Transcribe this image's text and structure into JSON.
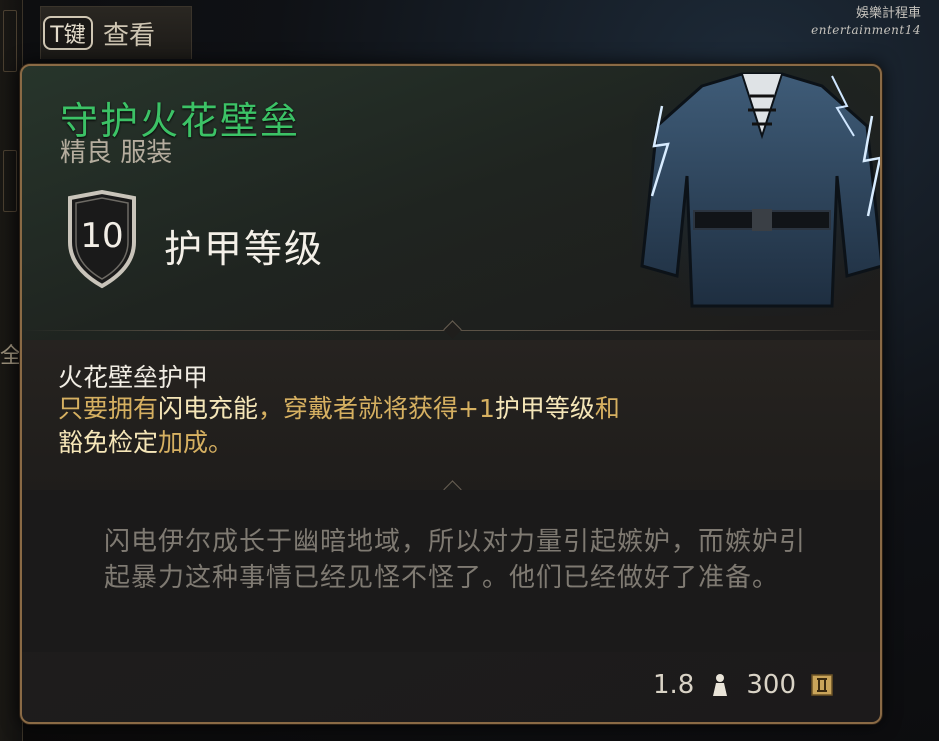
{
  "hint": {
    "key": "T键",
    "label": "查看"
  },
  "watermark": {
    "line1": "娛樂計程車",
    "line2": "entertainment14"
  },
  "item": {
    "name": "守护火花壁垒",
    "rarity_type": "精良 服装",
    "name_color": "#3cc266"
  },
  "armor": {
    "value": "10",
    "label": "护甲等级"
  },
  "effect": {
    "title": "火花壁垒护甲",
    "line1_pre": "只要拥有",
    "line1_hl1": "闪电充能",
    "line1_mid": "，穿戴者就将获得+1",
    "line1_hl2": "护甲等级",
    "line1_post": "和",
    "line2_hl": "豁免检定",
    "line2_post": "加成。"
  },
  "lore": {
    "text": "闪电伊尔成长于幽暗地域，所以对力量引起嫉妒，而嫉妒引起暴力这种事情已经见怪不怪了。他们已经做好了准备。"
  },
  "footer": {
    "weight": "1.8",
    "weight_icon": "weight-icon",
    "value": "300",
    "value_icon": "gold-icon"
  },
  "left_glyph": "全",
  "colors": {
    "border": "#8a6a45",
    "effect_text": "#d6b061",
    "highlight": "#f5e6b8",
    "lore_text": "#7f7a72"
  }
}
